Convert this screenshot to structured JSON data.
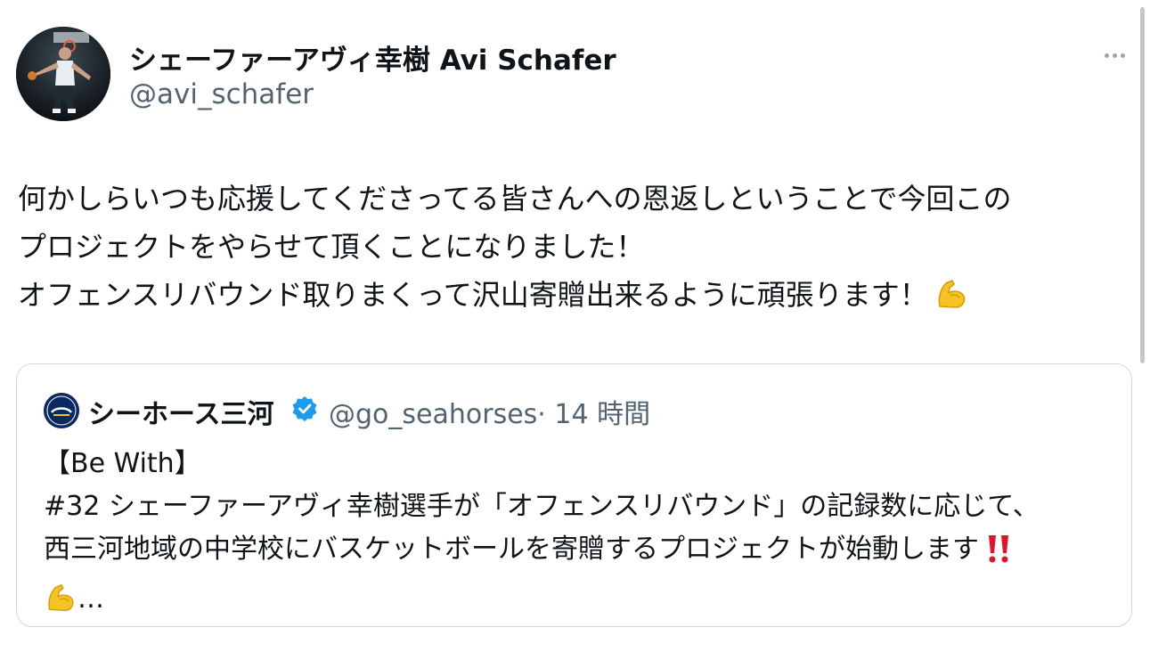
{
  "author": {
    "display_name": "シェーファーアヴィ幸樹 Avi Schafer",
    "handle": "@avi_schafer",
    "avatar_icon": "basketball-player-avatar"
  },
  "tweet": {
    "lines": [
      "何かしらいつも応援してくださってる皆さんへの恩返しということで今回この",
      "プロジェクトをやらせて頂くことになりました！",
      "オフェンスリバウンド取りまくって沢山寄贈出来るように頑張ります！"
    ],
    "emoji_icon": "flexed-biceps-emoji"
  },
  "quote": {
    "display_name": "シーホース三河",
    "handle": "@go_seahorses",
    "time": "· 14 時間",
    "verified": true,
    "lines": [
      "【Be With】",
      "#32 シェーファーアヴィ幸樹選手が「オフェンスリバウンド」の記録数に応じて、",
      "西三河地域の中学校にバスケットボールを寄贈するプロジェクトが始動します",
      "…"
    ]
  },
  "colors": {
    "text": "#0f1419",
    "secondary": "#536471",
    "verified": "#1d9bf0",
    "border": "#cfd9de"
  }
}
